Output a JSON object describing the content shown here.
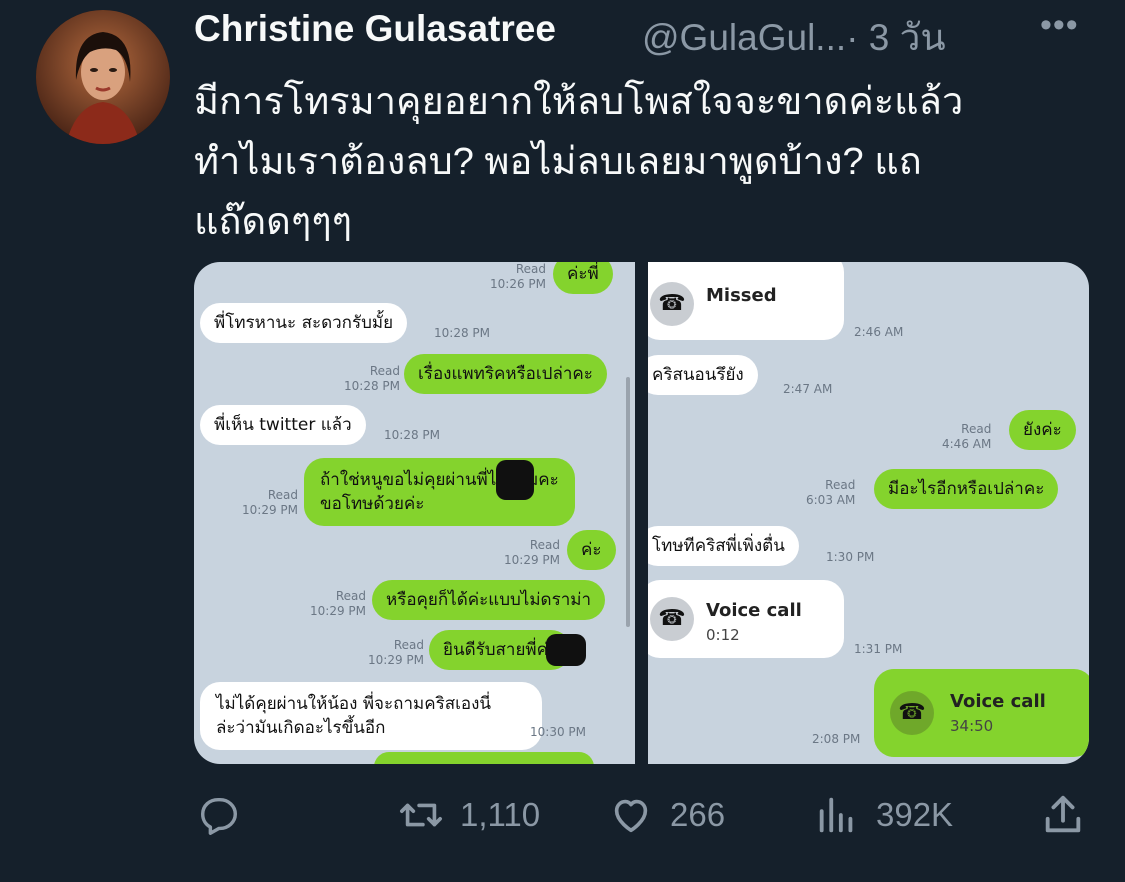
{
  "tweet": {
    "author_name": "Christine Gulasatree",
    "author_handle": "@GulaGul...",
    "timestamp": "· 3 วัน",
    "more_label": "•••",
    "text_lines": [
      "มีการโทรมาคุยอยากให้ลบโพสใจจะขาดค่ะแล้ว",
      "ทำไมเราต้องลบ? พอไม่ลบเลยมาพูดบ้าง? แถ",
      "แถ๊ดดๆๆๆ"
    ]
  },
  "screenshot_left": {
    "messages": [
      {
        "text": "ค่ะพี่",
        "meta_read": "Read",
        "meta_time": "10:26 PM"
      },
      {
        "text": "พี่โทรหานะ สะดวกรับมั้ย",
        "meta_time": "10:28 PM"
      },
      {
        "text": "เรื่องแพทริคหรือเปล่าคะ",
        "meta_read": "Read",
        "meta_time": "10:28 PM"
      },
      {
        "text": "พี่เห็น twitter แล้ว",
        "meta_time": "10:28 PM"
      },
      {
        "text_line1": "ถ้าใช่หนูขอไม่คุยผ่านพี่ได้ไหมคะ",
        "text_line2": "ขอโทษด้วยค่ะ",
        "meta_read": "Read",
        "meta_time": "10:29 PM"
      },
      {
        "text": "ค่ะ",
        "meta_read": "Read",
        "meta_time": "10:29 PM"
      },
      {
        "text": "หรือคุยก็ได้ค่ะแบบไม่ดราม่า",
        "meta_read": "Read",
        "meta_time": "10:29 PM"
      },
      {
        "text": "ยินดีรับสายพี่ค่ะ",
        "meta_read": "Read",
        "meta_time": "10:29 PM"
      },
      {
        "text_line1": "ไม่ได้คุยผ่านให้น้อง พี่จะถามคริสเองนี่",
        "text_line2": "ล่ะว่ามันเกิดอะไรขึ้นอีก",
        "meta_time": "10:30 PM"
      }
    ]
  },
  "screenshot_right": {
    "messages": [
      {
        "call_title": "Missed",
        "meta_time": "2:46 AM"
      },
      {
        "text": "คริสนอนรึยัง",
        "meta_time": "2:47 AM"
      },
      {
        "text": "ยังค่ะ",
        "meta_read": "Read",
        "meta_time": "4:46 AM"
      },
      {
        "text": "มีอะไรอีกหรือเปล่าคะ",
        "meta_read": "Read",
        "meta_time": "6:03 AM"
      },
      {
        "text": "โทษทีคริสพี่เพิ่งตื่น",
        "meta_time": "1:30 PM"
      },
      {
        "call_title": "Voice call",
        "call_duration": "0:12",
        "meta_time": "1:31 PM"
      },
      {
        "call_title": "Voice call",
        "call_duration": "34:50",
        "meta_time": "2:08 PM"
      }
    ]
  },
  "actions": {
    "reply_icon": "reply-bubble-icon",
    "retweet_icon": "retweet-icon",
    "retweet_count": "1,110",
    "like_icon": "heart-icon",
    "like_count": "266",
    "views_icon": "views-bar-chart-icon",
    "views_count": "392K",
    "share_icon": "share-upload-icon"
  },
  "colors": {
    "background": "#15202b",
    "text_primary": "#f7f9f9",
    "text_secondary": "#8b98a5",
    "line_green": "#84d32d",
    "chat_background": "#c8d3de"
  }
}
